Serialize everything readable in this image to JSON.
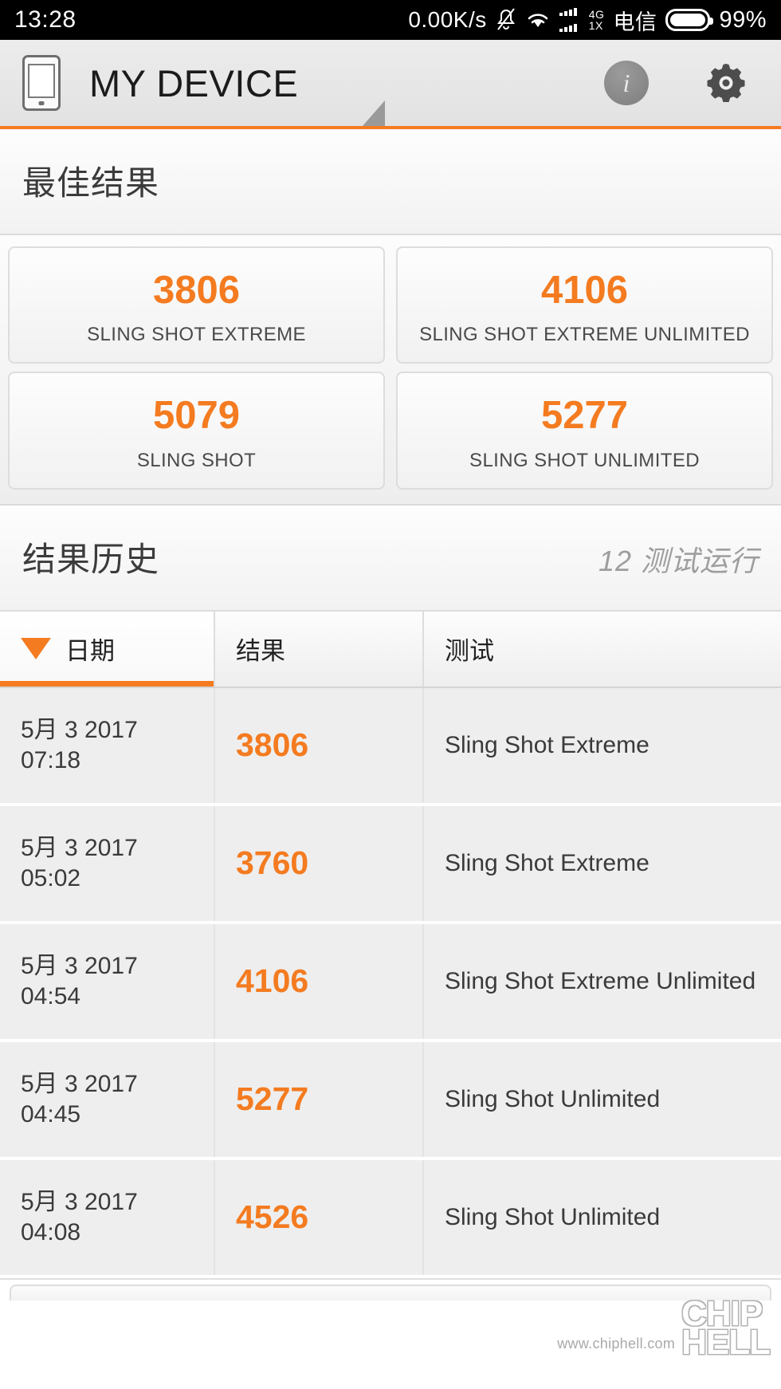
{
  "status_bar": {
    "time": "13:28",
    "network_speed": "0.00K/s",
    "mute_icon": "bell-muted-icon",
    "wifi_icon": "wifi-icon",
    "signal_icon": "signal-bars-icon",
    "network_type_primary": "4G",
    "network_type_secondary": "1X",
    "carrier": "电信",
    "battery_percent": "99%"
  },
  "app_bar": {
    "device_icon": "device-phone-icon",
    "title": "MY DEVICE",
    "info_icon": "info-icon",
    "info_label": "i",
    "settings_icon": "gear-icon"
  },
  "best_results": {
    "heading": "最佳结果",
    "cards": [
      {
        "score": "3806",
        "label": "SLING SHOT EXTREME"
      },
      {
        "score": "4106",
        "label": "SLING SHOT EXTREME UNLIMITED"
      },
      {
        "score": "5079",
        "label": "SLING SHOT"
      },
      {
        "score": "5277",
        "label": "SLING SHOT UNLIMITED"
      }
    ]
  },
  "result_history": {
    "heading": "结果历史",
    "runs_count": "12 测试运行",
    "columns": {
      "date": "日期",
      "result": "结果",
      "test": "测试"
    },
    "sort": {
      "column": "日期",
      "direction": "descending",
      "caret_icon": "caret-down-icon"
    },
    "rows": [
      {
        "date": "5月 3 2017",
        "time": "07:18",
        "result": "3806",
        "test": "Sling Shot Extreme"
      },
      {
        "date": "5月 3 2017",
        "time": "05:02",
        "result": "3760",
        "test": "Sling Shot Extreme"
      },
      {
        "date": "5月 3 2017",
        "time": "04:54",
        "result": "4106",
        "test": "Sling Shot Extreme Unlimited"
      },
      {
        "date": "5月 3 2017",
        "time": "04:45",
        "result": "5277",
        "test": "Sling Shot Unlimited"
      },
      {
        "date": "5月 3 2017",
        "time": "04:08",
        "result": "4526",
        "test": "Sling Shot Unlimited"
      }
    ]
  },
  "watermark": {
    "url": "www.chiphell.com",
    "logo_line1": "CHIP",
    "logo_line2": "HELL"
  },
  "colors": {
    "accent": "#f47b20",
    "status_bar_bg": "#000000",
    "row_bg": "#eeeeee",
    "text": "#3a3a3a"
  }
}
